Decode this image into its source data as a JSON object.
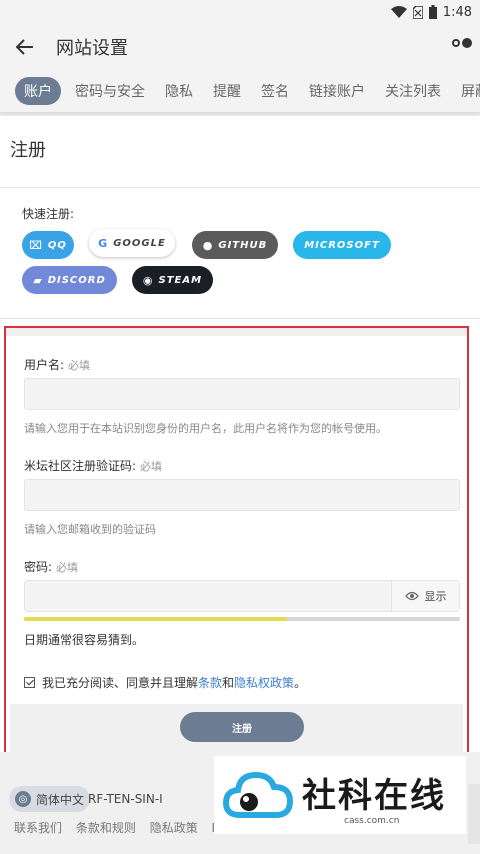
{
  "status": {
    "time": "1:48"
  },
  "header": {
    "title": "网站设置"
  },
  "tabs": [
    {
      "label": "账户",
      "active": true
    },
    {
      "label": "密码与安全"
    },
    {
      "label": "隐私"
    },
    {
      "label": "提醒"
    },
    {
      "label": "签名"
    },
    {
      "label": "链接账户"
    },
    {
      "label": "关注列表"
    },
    {
      "label": "屏蔽"
    }
  ],
  "register": {
    "title": "注册",
    "quick_label": "快速注册:"
  },
  "providers": [
    {
      "label": "QQ",
      "color": "#3aa3e8"
    },
    {
      "label": "GOOGLE",
      "color": "#ffffff"
    },
    {
      "label": "GITHUB",
      "color": "#5b5b5b"
    },
    {
      "label": "MICROSOFT",
      "color": "#29b6e8"
    },
    {
      "label": "DISCORD",
      "color": "#7289da"
    },
    {
      "label": "STEAM",
      "color": "#1b1f25"
    }
  ],
  "form": {
    "username_label": "用户名:",
    "username_req": "必填",
    "username_hint": "请输入您用于在本站识别您身份的用户名，此用户名将作为您的帐号使用。",
    "code_label": "米坛社区注册验证码:",
    "code_req": "必填",
    "code_hint": "请输入您邮箱收到的验证码",
    "password_label": "密码:",
    "password_req": "必填",
    "show_label": "显示",
    "strength_fraction": 0.6,
    "strength_text": "日期通常很容易猜到。",
    "agree_prefix": "我已充分阅读、同意并且理解",
    "agree_terms": "条款",
    "agree_and": "和",
    "agree_privacy": "隐私权政策",
    "agree_suffix": "。",
    "submit_label": "注册"
  },
  "footer": {
    "language": "简体中文",
    "code": "RF-TEN-SIN-I",
    "links": [
      "联系我们",
      "条款和规则",
      "隐私政策",
      "DM"
    ]
  },
  "watermark": {
    "name": "社科在线",
    "url": "cass.com.cn"
  }
}
